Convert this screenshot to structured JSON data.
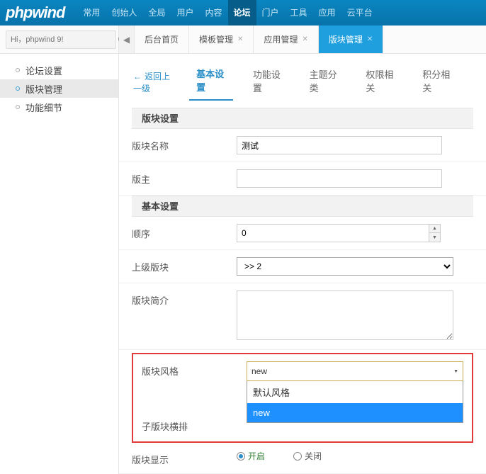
{
  "topnav": {
    "logo": "phpwind",
    "items": [
      "常用",
      "创始人",
      "全局",
      "用户",
      "内容",
      "论坛",
      "门户",
      "工具",
      "应用",
      "云平台"
    ],
    "active_index": 5
  },
  "search": {
    "placeholder": "Hi，phpwind 9!"
  },
  "tabs": {
    "items": [
      {
        "label": "后台首页",
        "closable": false
      },
      {
        "label": "模板管理",
        "closable": true
      },
      {
        "label": "应用管理",
        "closable": true
      },
      {
        "label": "版块管理",
        "closable": true
      }
    ],
    "active_index": 3
  },
  "sidebar": {
    "items": [
      "论坛设置",
      "版块管理",
      "功能细节"
    ],
    "active_index": 1
  },
  "subnav": {
    "back": "返回上一级",
    "items": [
      "基本设置",
      "功能设置",
      "主题分类",
      "权限相关",
      "积分相关"
    ],
    "active_index": 0
  },
  "sections": {
    "s1": {
      "title": "版块设置"
    },
    "s2": {
      "title": "基本设置"
    }
  },
  "form": {
    "name_label": "版块名称",
    "name_value": "测试",
    "owner_label": "版主",
    "owner_value": "",
    "order_label": "顺序",
    "order_value": "0",
    "parent_label": "上级版块",
    "parent_value": ">> 2",
    "desc_label": "版块简介",
    "desc_value": "",
    "style_label": "版块风格",
    "style_value": "new",
    "style_options": [
      "默认风格",
      "new"
    ],
    "style_selected_index": 1,
    "childlayout_label": "子版块横排",
    "display_label": "版块显示",
    "display_on": "开启",
    "display_off": "关闭"
  }
}
